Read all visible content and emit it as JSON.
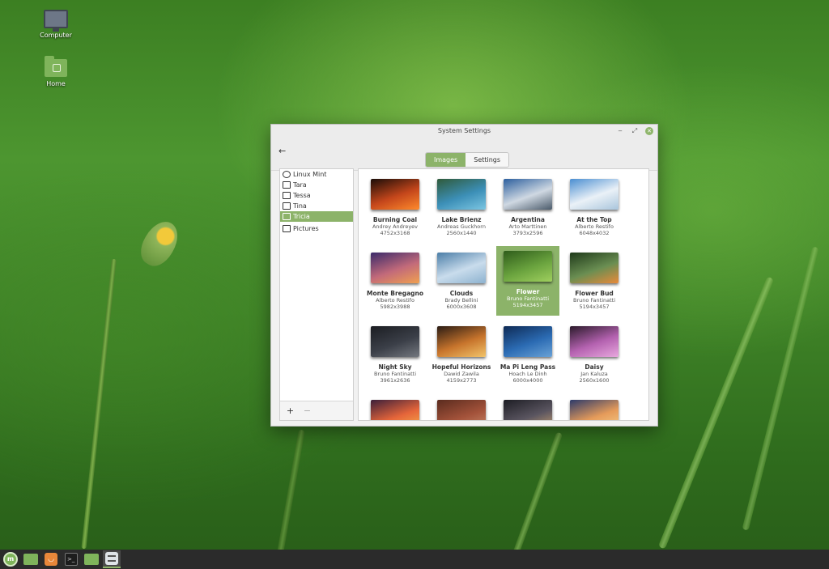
{
  "desktop": {
    "icons": [
      {
        "label": "Computer",
        "icon": "computer-icon"
      },
      {
        "label": "Home",
        "icon": "home-folder-icon"
      }
    ]
  },
  "window": {
    "title": "System Settings",
    "controls": {
      "minimize": "‒",
      "maximize": "⤢",
      "close": "✕"
    },
    "back": "←",
    "tabs": [
      {
        "label": "Images",
        "active": true
      },
      {
        "label": "Settings",
        "active": false
      }
    ],
    "sidebar": {
      "items": [
        {
          "label": "Linux Mint",
          "icon": "globe-icon",
          "selected": false
        },
        {
          "label": "Tara",
          "icon": "monitor-icon",
          "selected": false
        },
        {
          "label": "Tessa",
          "icon": "monitor-icon",
          "selected": false
        },
        {
          "label": "Tina",
          "icon": "monitor-icon",
          "selected": false
        },
        {
          "label": "Tricia",
          "icon": "monitor-icon",
          "selected": true
        },
        {
          "label": "Pictures",
          "icon": "camera-icon",
          "selected": false
        }
      ],
      "add": "+",
      "remove": "−"
    },
    "gallery": [
      {
        "name": "Burning Coal",
        "author": "Andrey Andreyev",
        "resolution": "4752x3168",
        "colors": [
          "#1a0d08",
          "#c4461b",
          "#ff8b2c"
        ]
      },
      {
        "name": "Lake Brienz",
        "author": "Andreas Guckhorn",
        "resolution": "2560x1440",
        "colors": [
          "#2f5a3a",
          "#3c8fb7",
          "#7cc6e2"
        ]
      },
      {
        "name": "Argentina",
        "author": "Arto Marttinen",
        "resolution": "3793x2596",
        "colors": [
          "#2c5f9e",
          "#cfd8e2",
          "#4a5a6a"
        ]
      },
      {
        "name": "At the Top",
        "author": "Alberto Restifo",
        "resolution": "6048x4032",
        "colors": [
          "#4a8ed1",
          "#eaf1f7",
          "#a9c5dc"
        ]
      },
      {
        "name": "Monte Bregagno",
        "author": "Alberto Restifo",
        "resolution": "5982x3988",
        "colors": [
          "#3a2a6a",
          "#c26a7a",
          "#f0a050"
        ]
      },
      {
        "name": "Clouds",
        "author": "Brady Bellini",
        "resolution": "6000x3608",
        "colors": [
          "#4b7ea8",
          "#c9dcec",
          "#8db2cf"
        ]
      },
      {
        "name": "Flower",
        "author": "Bruno Fantinatti",
        "resolution": "5194x3457",
        "colors": [
          "#2f5d1b",
          "#6aa33e",
          "#9fcf5e"
        ],
        "selected": true
      },
      {
        "name": "Flower Bud",
        "author": "Bruno Fantinatti",
        "resolution": "5194x3457",
        "colors": [
          "#1f3a1a",
          "#6a8e52",
          "#e98a3a"
        ]
      },
      {
        "name": "Night Sky",
        "author": "Bruno Fantinatti",
        "resolution": "3961x2636",
        "colors": [
          "#1b1d22",
          "#3b3f48",
          "#74787f"
        ]
      },
      {
        "name": "Hopeful Horizons",
        "author": "Dawid Zawila",
        "resolution": "4159x2773",
        "colors": [
          "#2a1c14",
          "#c7742c",
          "#f2c46a"
        ]
      },
      {
        "name": "Ma Pi Leng Pass",
        "author": "Hoach Le Dinh",
        "resolution": "6000x4000",
        "colors": [
          "#0e2a55",
          "#2b6bb3",
          "#6aa2d6"
        ]
      },
      {
        "name": "Daisy",
        "author": "Jan Kaluza",
        "resolution": "2560x1600",
        "colors": [
          "#2b1a2b",
          "#b462b0",
          "#e8a8de"
        ]
      },
      {
        "name": "",
        "author": "",
        "resolution": "",
        "colors": [
          "#3b1f3a",
          "#e5653a",
          "#f8b24a"
        ]
      },
      {
        "name": "",
        "author": "",
        "resolution": "",
        "colors": [
          "#5a2b1e",
          "#a3523a",
          "#c98a6a"
        ]
      },
      {
        "name": "",
        "author": "",
        "resolution": "",
        "colors": [
          "#1d1d24",
          "#5a5560",
          "#c8a070"
        ]
      },
      {
        "name": "",
        "author": "",
        "resolution": "",
        "colors": [
          "#2c3a6a",
          "#e59b5a",
          "#f6cf8a"
        ]
      }
    ]
  },
  "taskbar": {
    "items": [
      {
        "name": "mint-menu-icon",
        "glyph": "m",
        "active": false
      },
      {
        "name": "files-folder-icon",
        "glyph": "",
        "active": false
      },
      {
        "name": "software-manager-icon",
        "glyph": "◡",
        "active": false
      },
      {
        "name": "terminal-icon",
        "glyph": ">_",
        "active": false
      },
      {
        "name": "folder-icon",
        "glyph": "",
        "active": false
      },
      {
        "name": "system-settings-icon",
        "glyph": "",
        "active": true
      }
    ]
  },
  "colors": {
    "accent": "#8cb369"
  }
}
